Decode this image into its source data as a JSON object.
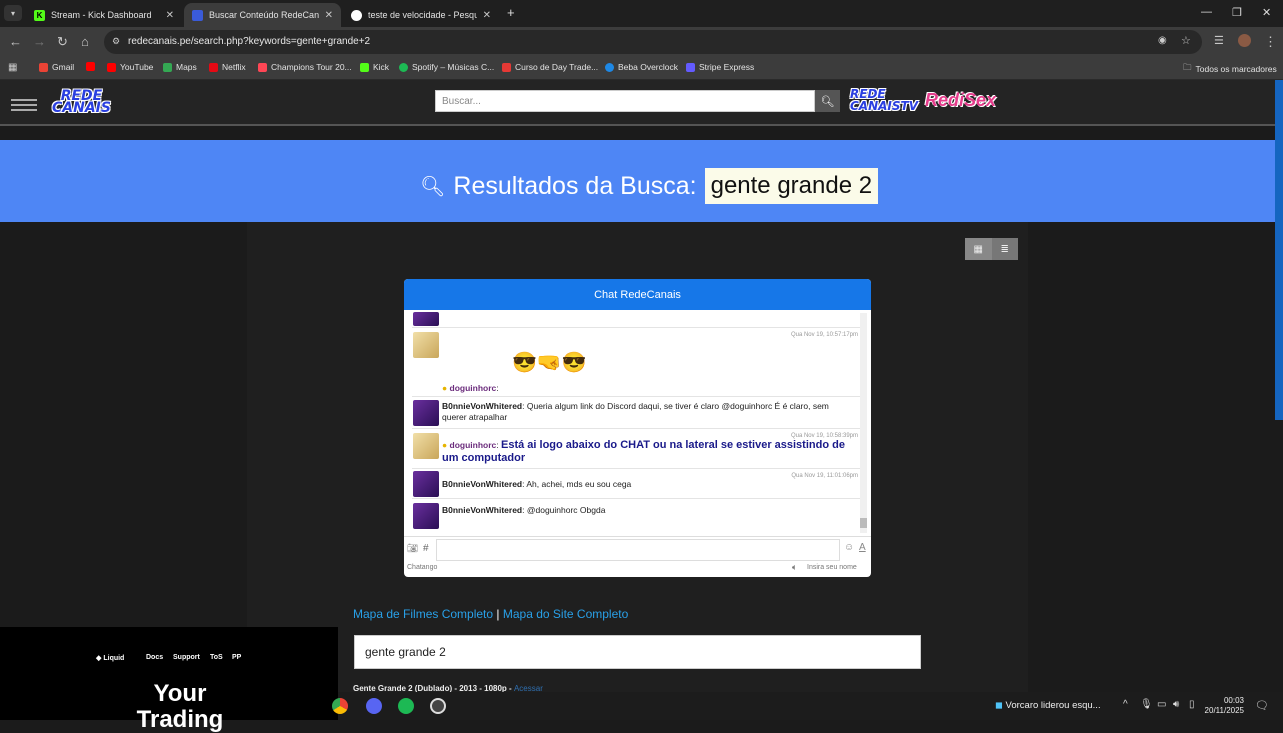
{
  "browser": {
    "tabs": [
      {
        "title": "Stream - Kick Dashboard",
        "color": "#53fc18",
        "active": false
      },
      {
        "title": "Buscar Conteúdo RedeCanais: g",
        "color": "#3a5bd9",
        "active": true
      },
      {
        "title": "teste de velocidade - Pesquisa",
        "color": "#ffffff",
        "active": false
      }
    ],
    "new_tab": "+",
    "url": "redecanais.pe/search.php?keywords=gente+grande+2",
    "bookmarks": [
      {
        "label": "Gmail",
        "color": "#ea4335"
      },
      {
        "label": "",
        "color": "#ff0000"
      },
      {
        "label": "YouTube",
        "color": "#ff0000"
      },
      {
        "label": "Maps",
        "color": "#34a853"
      },
      {
        "label": "Netflix",
        "color": "#e50914"
      },
      {
        "label": "Champions Tour 20...",
        "color": "#ff4655"
      },
      {
        "label": "Kick",
        "color": "#53fc18"
      },
      {
        "label": "Spotify – Músicas C...",
        "color": "#1db954"
      },
      {
        "label": "Curso de Day Trade...",
        "color": "#e53935"
      },
      {
        "label": "Beba Overclock",
        "color": "#1e88e5"
      },
      {
        "label": "Stripe Express",
        "color": "#635bff"
      }
    ],
    "all_bookmarks": "Todos os marcadores"
  },
  "site": {
    "logo_line1": "REDE",
    "logo_line2": "CANAIS",
    "logo_right_1": "REDE",
    "logo_right_2": "CANAISTV",
    "logo_right_3": "RediSex",
    "search_placeholder": "Buscar...",
    "results_label": "Resultados da Busca:",
    "results_query": "gente grande 2"
  },
  "chat": {
    "title": "Chat RedeCanais",
    "messages": [
      {
        "time": "Qua Nov 19, 10:57:17pm",
        "user": "doguinhorc",
        "text": ":"
      },
      {
        "time": "",
        "user": "B0nnieVonWhitered",
        "text": "Queria algum link do Discord daqui, se tiver é claro @doguinhorc É é claro, sem querer atrapalhar"
      },
      {
        "time": "Qua Nov 19, 10:58:39pm",
        "user": "doguinhorc",
        "text": "Está ai logo abaixo do CHAT ou na lateral se estiver assistindo de um computador"
      },
      {
        "time": "Qua Nov 19, 11:01:06pm",
        "user": "B0nnieVonWhitered",
        "text": "Ah, achei, mds eu sou cega"
      },
      {
        "time": "",
        "user": "B0nnieVonWhitered",
        "text": "@doguinhorc Obgda"
      }
    ],
    "hash": "#",
    "footer_left": "Chatango",
    "footer_right": "Insira seu nome"
  },
  "links": {
    "movies_map": "Mapa de Filmes Completo",
    "separator": "|",
    "site_map": "Mapa do Site Completo"
  },
  "query_box": "gente grande 2",
  "result": {
    "text": "Gente Grande 2 (Dublado) - 2013 - 1080p -",
    "link": "Acessar"
  },
  "overlay": {
    "brand": "Liquid",
    "nav": [
      "Docs",
      "Support",
      "ToS",
      "PP"
    ],
    "hero": "Your Trading"
  },
  "taskbar": {
    "news": "Vorcaro liderou esqu...",
    "time": "00:03",
    "date": "20/11/2025"
  }
}
